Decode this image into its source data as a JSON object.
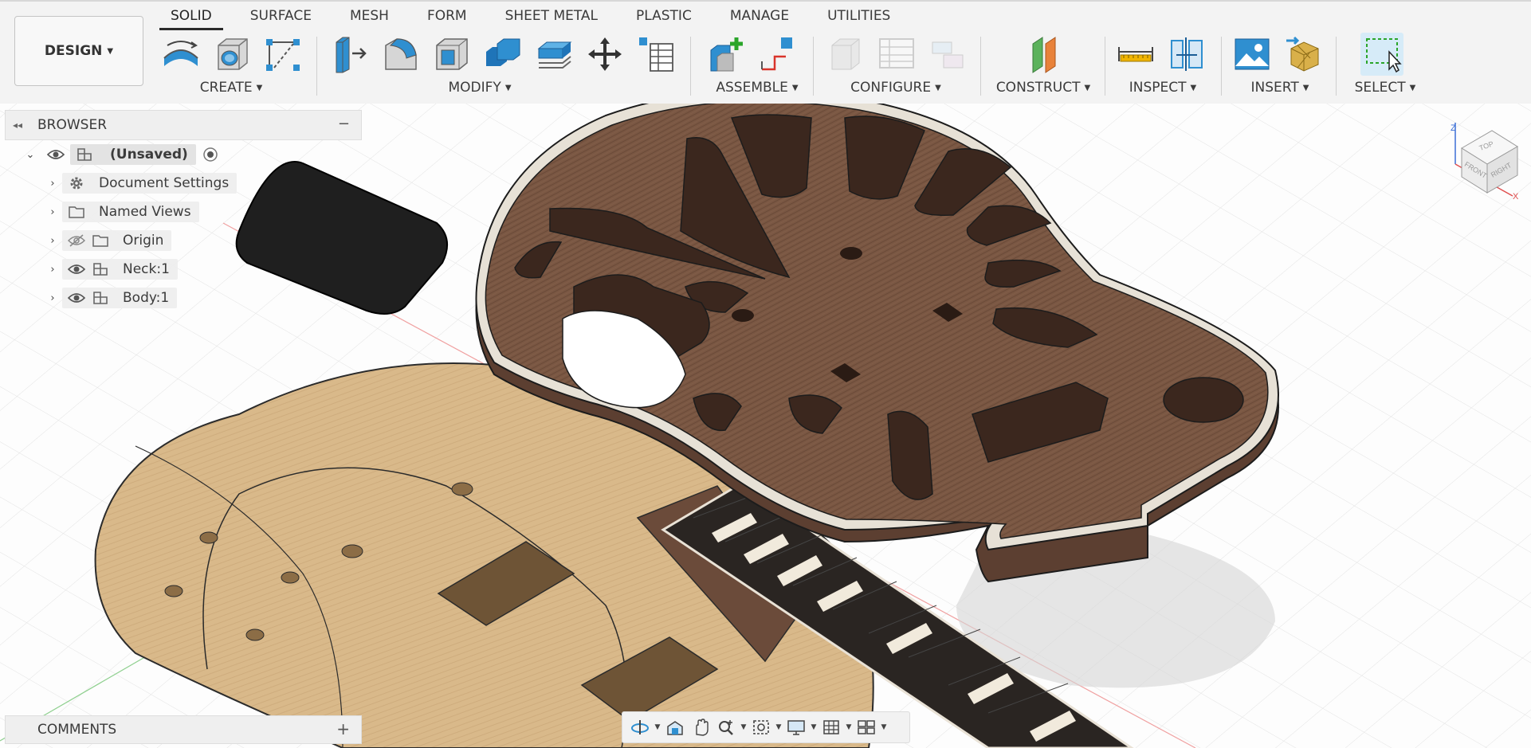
{
  "toolbar": {
    "workspace": "DESIGN",
    "tabs": [
      "SOLID",
      "SURFACE",
      "MESH",
      "FORM",
      "SHEET METAL",
      "PLASTIC",
      "MANAGE",
      "UTILITIES"
    ],
    "groups": {
      "create": "CREATE",
      "modify": "MODIFY",
      "assemble": "ASSEMBLE",
      "configure": "CONFIGURE",
      "construct": "CONSTRUCT",
      "inspect": "INSPECT",
      "insert": "INSERT",
      "select": "SELECT"
    }
  },
  "browser": {
    "title": "BROWSER",
    "root": "(Unsaved)",
    "items": [
      "Document Settings",
      "Named Views",
      "Origin",
      "Neck:1",
      "Body:1"
    ]
  },
  "comments": {
    "title": "COMMENTS"
  },
  "viewcube": {
    "top": "TOP",
    "front": "FRONT",
    "right": "RIGHT",
    "x": "X",
    "z": "Z"
  },
  "colors": {
    "accent": "#0696d7",
    "wood_dark": "#7a5743",
    "wood_light": "#d9b98a",
    "fretboard": "#2a2522"
  }
}
